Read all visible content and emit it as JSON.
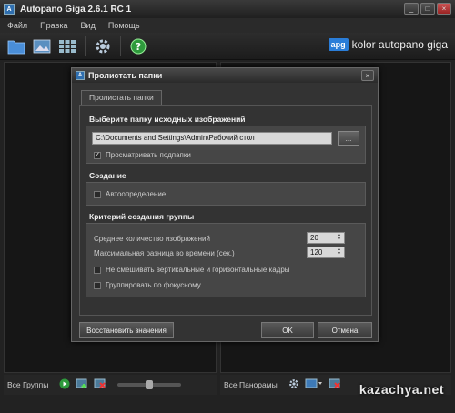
{
  "window": {
    "title": "Autopano Giga 2.6.1 RC 1",
    "minimize": "_",
    "maximize": "□",
    "close": "×"
  },
  "menu": {
    "items": [
      "Файл",
      "Правка",
      "Вид",
      "Помощь"
    ]
  },
  "brand": {
    "badge": "apg",
    "text": "kolor autopano giga"
  },
  "bottom_left": {
    "label": "Все Группы"
  },
  "bottom_right": {
    "label": "Все Панорамы"
  },
  "watermark": "kazachya.net",
  "dialog": {
    "title": "Пролистать папки",
    "close": "×",
    "tab": "Пролистать папки",
    "source": {
      "heading": "Выберите папку исходных изображений",
      "path": "C:\\Documents and Settings\\Admin\\Рабочий стол",
      "browse": "...",
      "subfolders_label": "Просматривать подпапки",
      "subfolders_checked": true
    },
    "creation": {
      "heading": "Создание",
      "auto_label": "Автоопределение",
      "auto_checked": false
    },
    "group": {
      "heading": "Критерий создания группы",
      "avg_label": "Среднее количество изображений",
      "avg_value": "20",
      "maxtime_label": "Максимальная разница во времени (сек.)",
      "maxtime_value": "120",
      "nomix_label": "Не смешивать вертикальные и горизонтальные кадры",
      "nomix_checked": false,
      "focus_label": "Группировать по фокусному",
      "focus_checked": false
    },
    "restore_button": "Восстановить значения",
    "ok_button": "OK",
    "cancel_button": "Отмена"
  },
  "colors": {
    "accent": "#2a7dd8",
    "background": "#222222",
    "dialog": "#333333"
  }
}
